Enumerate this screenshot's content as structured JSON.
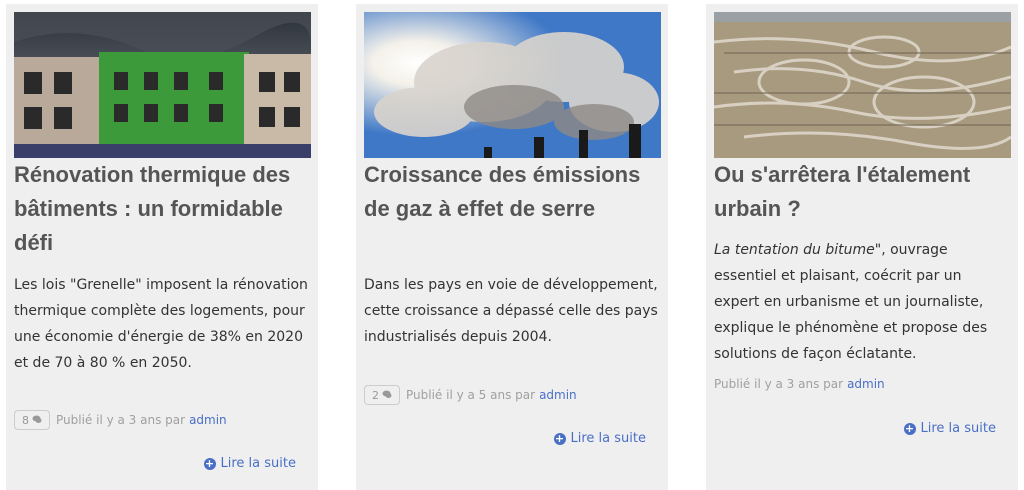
{
  "articles": [
    {
      "title": "Rénovation thermique des bâtiments : un formidable défi",
      "excerpt": "Les lois \"Grenelle\" imposent la rénovation thermique complète des logements, pour une économie d'énergie de 38% en 2020 et de 70 à 80 % en 2050.",
      "comments": "8",
      "published": "Publié il y a 3 ans par",
      "author": "admin",
      "read_more": "Lire la suite"
    },
    {
      "title": "Croissance des émissions de gaz à effet de serre",
      "excerpt": "Dans les pays en voie de développement, cette croissance a dépassé celle des pays industrialisés depuis 2004.",
      "comments": "2",
      "published": "Publié il y a 5 ans par",
      "author": "admin",
      "read_more": "Lire la suite"
    },
    {
      "title": "Ou s'arrêtera l'étalement urbain ?",
      "excerpt_italic": "La tentation du bitume",
      "excerpt_rest": "\", ouvrage essentiel et plaisant, coécrit par un expert en urbanisme et un journaliste, explique le phénomène et propose des solutions de façon éclatante.",
      "published": "Publié il y a 3 ans par",
      "author": "admin",
      "read_more": "Lire la suite"
    }
  ],
  "icons": {
    "comment": "comment-icon",
    "read_more": "plus-circle-icon"
  },
  "colors": {
    "link": "#4a6fc7",
    "card_bg": "#efefef",
    "title": "#555555"
  }
}
